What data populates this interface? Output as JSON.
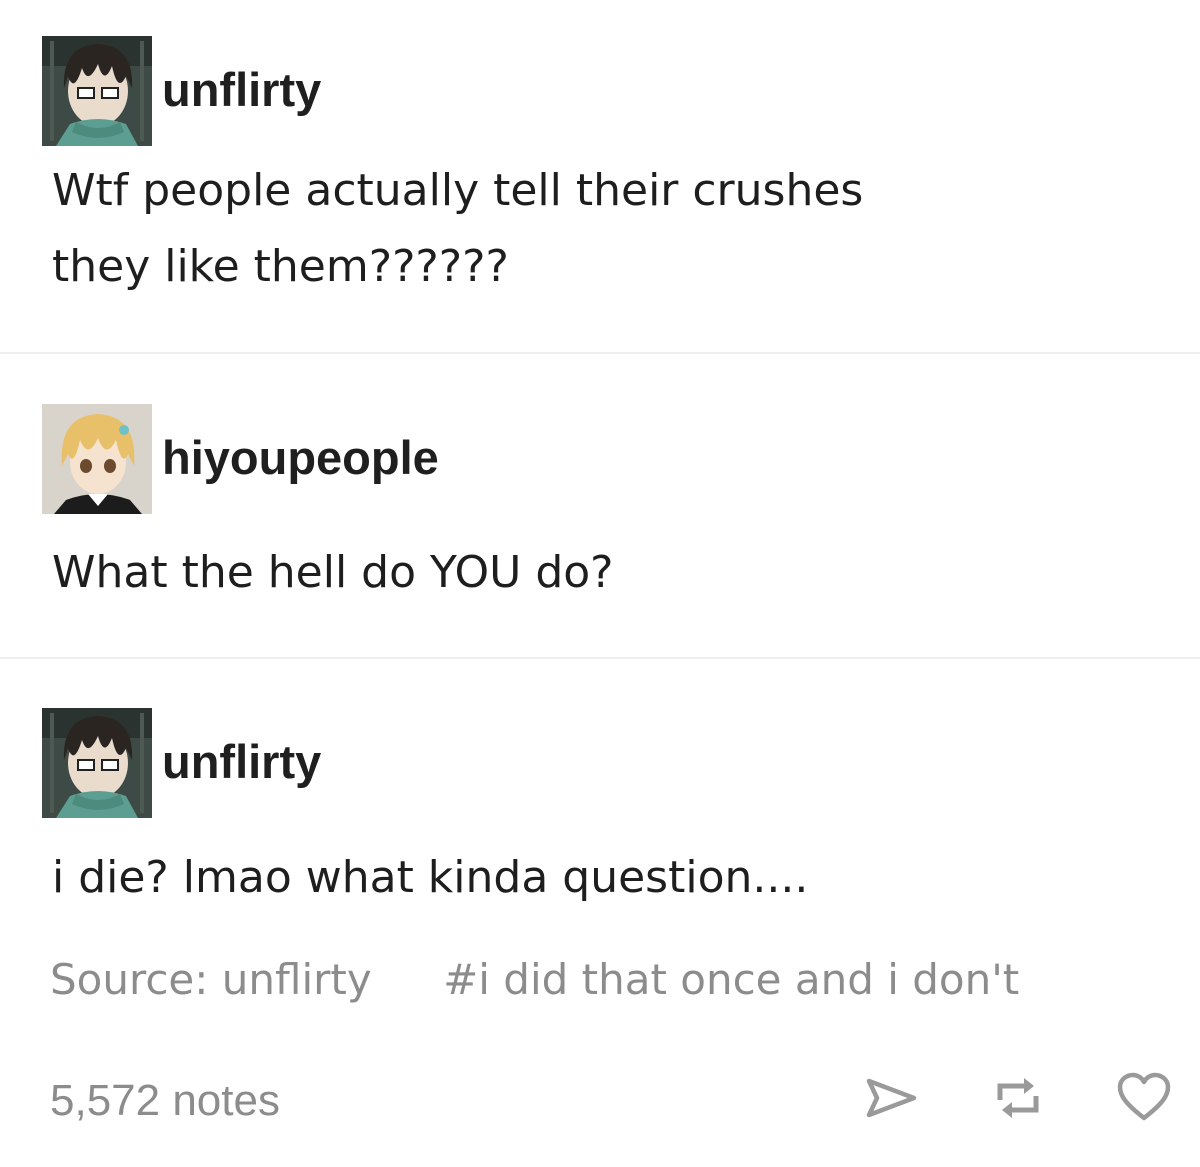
{
  "posts": [
    {
      "username": "unflirty",
      "avatar_icon": "dark-haired-anime-avatar-icon",
      "lines": [
        "Wtf people actually tell their crushes",
        "they like them??????"
      ]
    },
    {
      "username": "hiyoupeople",
      "avatar_icon": "blonde-anime-avatar-icon",
      "lines": [
        "What the hell do YOU do?"
      ]
    },
    {
      "username": "unflirty",
      "avatar_icon": "dark-haired-anime-avatar-icon",
      "lines": [
        "i die? lmao what kinda question...."
      ]
    }
  ],
  "footer": {
    "source": "Source: unflirty",
    "tag": "#i did that once and i don't",
    "notes": "5,572 notes",
    "actions": [
      "share-icon",
      "reblog-icon",
      "like-icon"
    ]
  },
  "colors": {
    "text": "#1e1e1e",
    "muted": "#8c8c8c",
    "divider": "#efefef"
  }
}
